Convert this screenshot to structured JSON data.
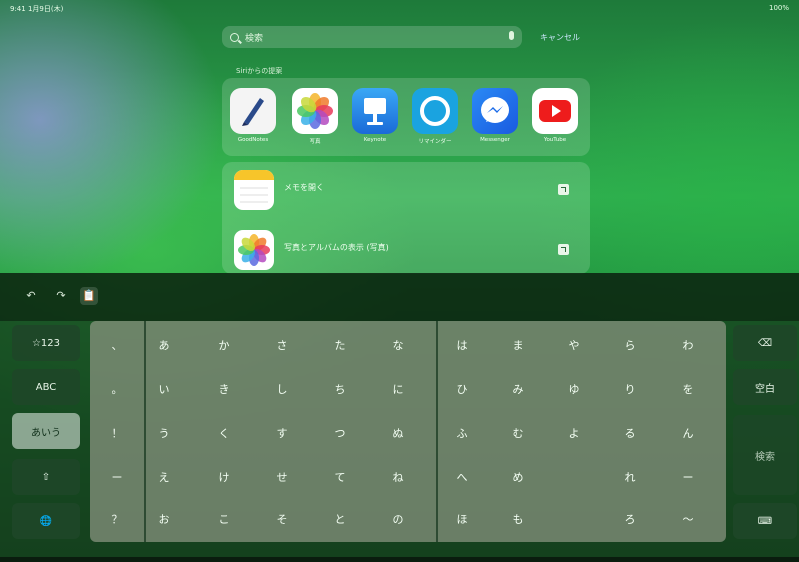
{
  "status": {
    "time": "9:41 1月9日(木)",
    "right": "100%"
  },
  "search": {
    "placeholder": "検索",
    "cancel": "キャンセル"
  },
  "siri_suggestions_label": "Siriからの提案",
  "apps": [
    {
      "label": "GoodNotes",
      "icon": "goodnotes-icon"
    },
    {
      "label": "写真",
      "icon": "photos-icon"
    },
    {
      "label": "Keynote",
      "icon": "keynote-icon"
    },
    {
      "label": "リマインダー",
      "icon": "alexa-icon"
    },
    {
      "label": "Messenger",
      "icon": "messenger-icon"
    },
    {
      "label": "YouTube",
      "icon": "youtube-icon"
    }
  ],
  "results": [
    {
      "title": "メモを開く",
      "icon": "notes-icon"
    },
    {
      "title": "写真とアルバムの表示 (写真)",
      "icon": "photos-icon"
    }
  ],
  "keyboard": {
    "side_left": [
      "☆123",
      "ABC",
      "あいう",
      "⇧",
      "🌐"
    ],
    "selected_mode": "あいう",
    "punctuation": [
      "、",
      "。",
      "！",
      "ー",
      "？"
    ],
    "kana_columns": [
      [
        "わ",
        "を",
        "ん",
        "ー",
        "〜"
      ],
      [
        "ら",
        "り",
        "る",
        "れ",
        "ろ"
      ],
      [
        "や",
        "ゆ",
        "よ",
        "",
        ""
      ],
      [
        "ま",
        "み",
        "む",
        "め",
        "も"
      ],
      [
        "は",
        "ひ",
        "ふ",
        "へ",
        "ほ"
      ],
      [
        "な",
        "に",
        "ぬ",
        "ね",
        "の"
      ],
      [
        "た",
        "ち",
        "つ",
        "て",
        "と"
      ],
      [
        "さ",
        "し",
        "す",
        "せ",
        "そ"
      ],
      [
        "か",
        "き",
        "く",
        "け",
        "こ"
      ],
      [
        "あ",
        "い",
        "う",
        "え",
        "お"
      ]
    ],
    "right_keys": {
      "delete": "⌫",
      "space": "空白",
      "search": "検索",
      "hide": "⌨"
    }
  },
  "toolbar": {
    "undo": "↶",
    "redo": "↷",
    "paste": "📋"
  }
}
